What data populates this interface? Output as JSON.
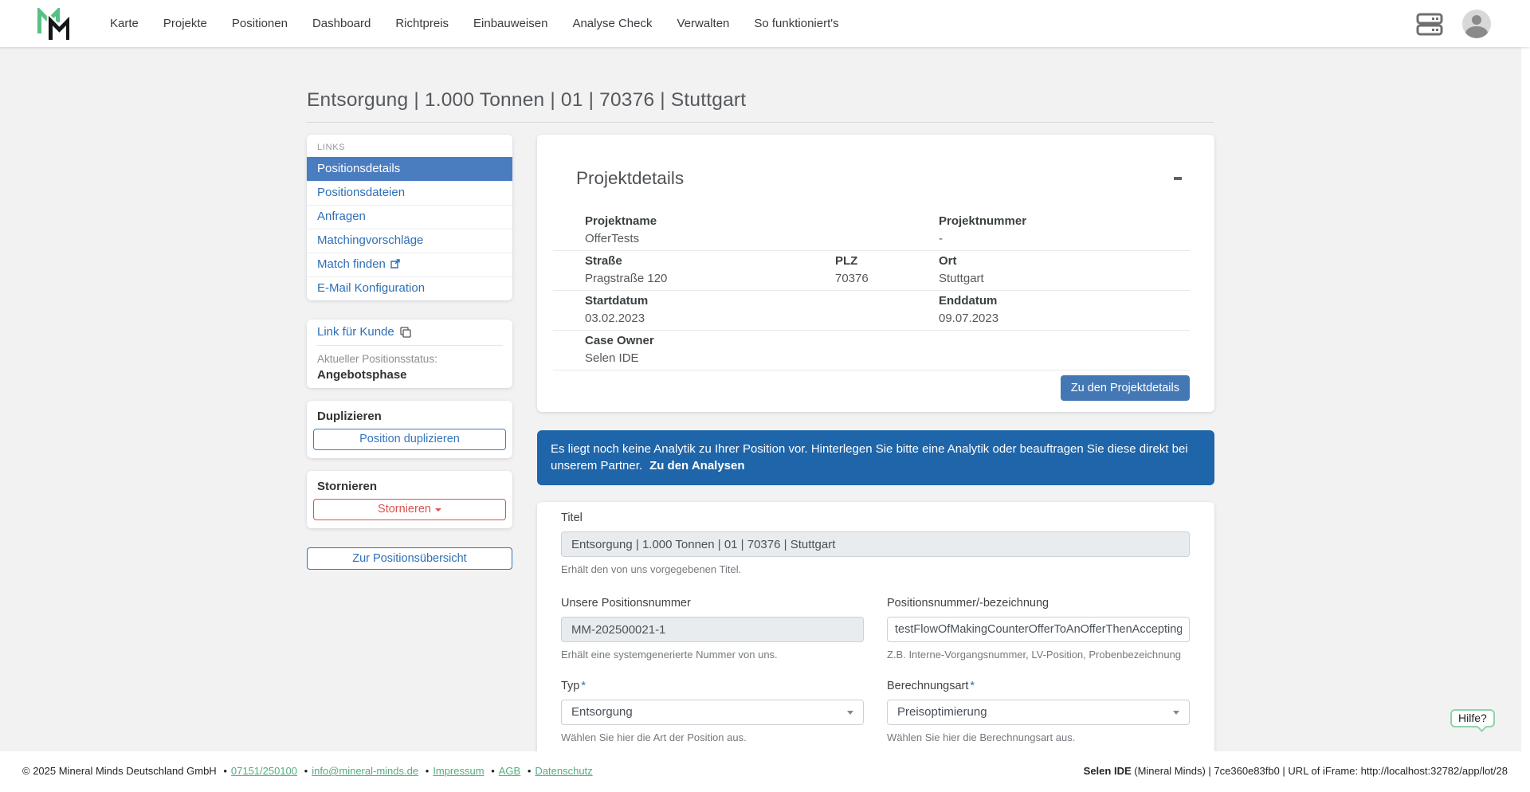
{
  "navbar": {
    "items": [
      "Karte",
      "Projekte",
      "Positionen",
      "Dashboard",
      "Richtpreis",
      "Einbauweisen",
      "Analyse Check",
      "Verwalten",
      "So funktioniert's"
    ]
  },
  "page": {
    "title": "Entsorgung | 1.000 Tonnen | 01 | 70376 | Stuttgart"
  },
  "sidebar": {
    "links_header": "LINKS",
    "items": [
      {
        "label": "Positionsdetails"
      },
      {
        "label": "Positionsdateien"
      },
      {
        "label": "Anfragen"
      },
      {
        "label": "Matchingvorschläge"
      },
      {
        "label": "Match finden"
      },
      {
        "label": "E-Mail Konfiguration"
      }
    ],
    "customer_link": "Link für Kunde",
    "status_label": "Aktueller Positionsstatus:",
    "status_value": "Angebotsphase",
    "duplicate": {
      "heading": "Duplizieren",
      "button": "Position duplizieren"
    },
    "cancel": {
      "heading": "Stornieren",
      "button": "Stornieren"
    },
    "overview_button": "Zur Positionsübersicht"
  },
  "project_details": {
    "heading": "Projektdetails",
    "rows": [
      {
        "c1l": "Projektname",
        "c1v": "OfferTests",
        "c3l": "Projektnummer",
        "c3v": "-"
      },
      {
        "c1l": "Straße",
        "c1v": "Pragstraße 120",
        "c2l": "PLZ",
        "c2v": "70376",
        "c3l": "Ort",
        "c3v": "Stuttgart"
      },
      {
        "c1l": "Startdatum",
        "c1v": "03.02.2023",
        "c3l": "Enddatum",
        "c3v": "09.07.2023"
      },
      {
        "c1l": "Case Owner",
        "c1v": "Selen IDE"
      }
    ],
    "button": "Zu den Projektdetails"
  },
  "banner": {
    "text": "Es liegt noch keine Analytik zu Ihrer Position vor. Hinterlegen Sie bitte eine Analytik oder beauftragen Sie diese direkt bei unserem Partner.",
    "link": "Zu den Analysen"
  },
  "form": {
    "titel": {
      "label": "Titel",
      "value": "Entsorgung | 1.000 Tonnen | 01 | 70376 | Stuttgart",
      "hint": "Erhält den von uns vorgegebenen Titel."
    },
    "our_number": {
      "label": "Unsere Positionsnummer",
      "value": "MM-202500021-1",
      "hint": "Erhält eine systemgenerierte Nummer von uns."
    },
    "pos_number": {
      "label": "Positionsnummer/-bezeichnung",
      "value": "testFlowOfMakingCounterOfferToAnOfferThenAccepting",
      "hint": "Z.B. Interne-Vorgangsnummer, LV-Position, Probenbezeichnung"
    },
    "typ": {
      "label": "Typ",
      "required": "*",
      "value": "Entsorgung",
      "hint": "Wählen Sie hier die Art der Position aus."
    },
    "berechnungsart": {
      "label": "Berechnungsart",
      "required": "*",
      "value": "Preisoptimierung",
      "hint": "Wählen Sie hier die Berechnungsart aus."
    }
  },
  "help_button": "Hilfe?",
  "footer": {
    "copyright": "© 2025 Mineral Minds Deutschland GmbH",
    "links": [
      "07151/250100",
      "info@mineral-minds.de",
      "Impressum",
      "AGB",
      "Datenschutz"
    ],
    "separator": "•",
    "right_bold": "Selen IDE",
    "right_rest": " (Mineral Minds) | 7ce360e83fb0 | URL of iFrame: http://localhost:32782/app/lot/28"
  },
  "colors": {
    "active_blue": "#4a7cc0",
    "banner_blue": "#1f65a9",
    "button_blue": "#4478b5",
    "link_blue": "#2e6fb6",
    "danger_red": "#d9534f",
    "footer_green": "#4fae7e",
    "logo_green": "#57c184"
  }
}
